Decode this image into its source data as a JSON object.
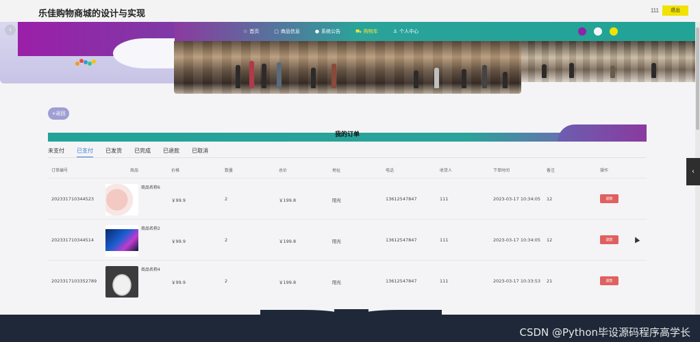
{
  "header": {
    "site_title": "乐佳购物商城的设计与实现",
    "user_name": "111",
    "logout_label": "退出"
  },
  "nav": {
    "items": [
      {
        "icon": "star-icon",
        "glyph": "☆",
        "label": "首页",
        "active": false
      },
      {
        "icon": "bag-icon",
        "glyph": "▢",
        "label": "商品信息",
        "active": false
      },
      {
        "icon": "dot-icon",
        "glyph": "●",
        "label": "系统公告",
        "active": false
      },
      {
        "icon": "cart-icon",
        "glyph": "⛟",
        "label": "购物车",
        "active": true
      },
      {
        "icon": "person-icon",
        "glyph": "♙",
        "label": "个人中心",
        "active": false
      }
    ],
    "theme_swatches": [
      "#8e24aa",
      "#f5f5f5",
      "#f2e200"
    ]
  },
  "back_label": "+返回",
  "section_title": "我的订单",
  "tabs": [
    {
      "label": "未支付",
      "active": false
    },
    {
      "label": "已支付",
      "active": true
    },
    {
      "label": "已发货",
      "active": false
    },
    {
      "label": "已完成",
      "active": false
    },
    {
      "label": "已退款",
      "active": false
    },
    {
      "label": "已取消",
      "active": false
    }
  ],
  "table": {
    "headers": [
      "订单编号",
      "商品",
      "价格",
      "数量",
      "总价",
      "地址",
      "电话",
      "收货人",
      "下单时间",
      "备注",
      "操作"
    ],
    "rows": [
      {
        "order_no": "202331710344523",
        "product_name": "商品名称6",
        "image": "product-fan-image",
        "price": "￥99.9",
        "qty": "2",
        "total": "￥199.8",
        "address": "阳光",
        "phone": "13612547847",
        "receiver": "111",
        "time": "2023-03-17 10:34:05",
        "note": "12",
        "action": "退款"
      },
      {
        "order_no": "202331710344514",
        "product_name": "商品名称2",
        "image": "product-tv-image",
        "price": "￥99.9",
        "qty": "2",
        "total": "￥199.8",
        "address": "阳光",
        "phone": "13612547847",
        "receiver": "111",
        "time": "2023-03-17 10:34:05",
        "note": "12",
        "action": "退款"
      },
      {
        "order_no": "2023317103352789",
        "product_name": "商品名称4",
        "image": "product-shoe-image",
        "price": "￥99.9",
        "qty": "2",
        "total": "￥199.8",
        "address": "阳光",
        "phone": "13612547847",
        "receiver": "111",
        "time": "2023-03-17 10:33:53",
        "note": "21",
        "action": "退款"
      }
    ]
  },
  "watermark": "CSDN @Python毕设源码程序高学长",
  "colors": {
    "nav_teal": "#21a396",
    "accent_purple": "#8a3a9f",
    "refund_red": "#e06060",
    "active_tab_blue": "#3a7bd5",
    "footer_navy": "#1e2838"
  }
}
